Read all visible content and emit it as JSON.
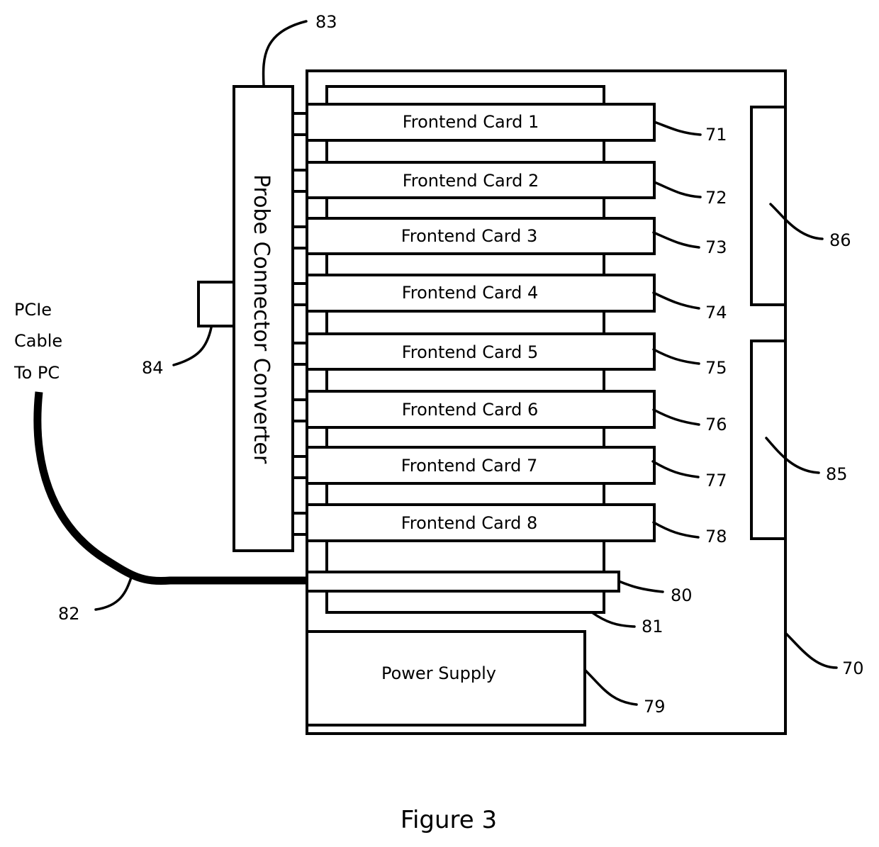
{
  "figure": {
    "caption": "Figure 3"
  },
  "enclosure": {
    "ref": "70"
  },
  "frontend_cards": [
    {
      "label": "Frontend Card 1",
      "ref": "71"
    },
    {
      "label": "Frontend Card 2",
      "ref": "72"
    },
    {
      "label": "Frontend Card 3",
      "ref": "73"
    },
    {
      "label": "Frontend Card 4",
      "ref": "74"
    },
    {
      "label": "Frontend Card 5",
      "ref": "75"
    },
    {
      "label": "Frontend Card 6",
      "ref": "76"
    },
    {
      "label": "Frontend Card 7",
      "ref": "77"
    },
    {
      "label": "Frontend Card 8",
      "ref": "78"
    }
  ],
  "power_supply": {
    "label": "Power Supply",
    "ref": "79"
  },
  "pcie_card": {
    "ref": "80"
  },
  "backplane": {
    "ref": "81"
  },
  "pcie_cable": {
    "ref": "82",
    "label_lines": [
      "PCIe",
      "Cable",
      "To PC"
    ]
  },
  "probe_connector_converter": {
    "label": "Probe Connector Converter",
    "ref": "83"
  },
  "probe_port": {
    "ref": "84"
  },
  "side_module_lower": {
    "ref": "85"
  },
  "side_module_upper": {
    "ref": "86"
  }
}
